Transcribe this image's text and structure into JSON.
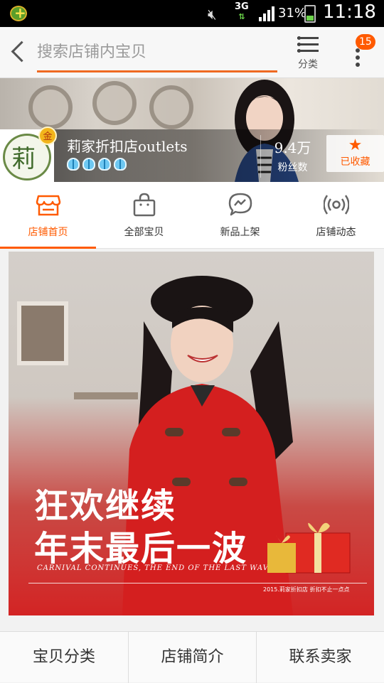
{
  "status_bar": {
    "network": "3G",
    "battery": "31%",
    "time": "11:18"
  },
  "header": {
    "search_placeholder": "搜索店铺内宝贝",
    "category_label": "分类",
    "badge_count": "15"
  },
  "shop": {
    "logo_char": "莉",
    "level_badge": "金",
    "name": "莉家折扣店outlets",
    "fans_count": "9.4万",
    "fans_label": "粉丝数",
    "favorite_label": "已收藏",
    "diamond_count": 4
  },
  "tabs": [
    {
      "label": "店铺首页",
      "icon": "store-icon",
      "active": true
    },
    {
      "label": "全部宝贝",
      "icon": "bag-icon",
      "active": false
    },
    {
      "label": "新品上架",
      "icon": "chat-bubble-icon",
      "active": false
    },
    {
      "label": "店铺动态",
      "icon": "broadcast-icon",
      "active": false
    }
  ],
  "promo": {
    "headline_1": "狂欢继续",
    "headline_2": "年末最后一波",
    "english": "CARNIVAL CONTINUES, THE END OF THE LAST WAVE",
    "footnote": "2015.莉家折扣店 折扣不止一点点"
  },
  "bottom_bar": {
    "categories": "宝贝分类",
    "shop_intro": "店铺简介",
    "contact_seller": "联系卖家"
  },
  "colors": {
    "accent": "#ff5a00",
    "promo_red": "#d32424"
  }
}
